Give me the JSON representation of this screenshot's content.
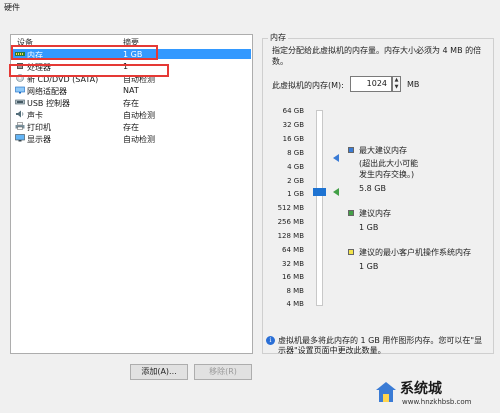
{
  "window": {
    "title": "硬件"
  },
  "device_list": {
    "header": {
      "device": "设备",
      "summary": "摘要"
    },
    "items": [
      {
        "name": "内存",
        "summary": "1 GB",
        "icon": "memory-icon"
      },
      {
        "name": "处理器",
        "summary": "1",
        "icon": "processor-icon"
      },
      {
        "name": "新 CD/DVD (SATA)",
        "summary": "自动检测",
        "icon": "cd-dvd-icon"
      },
      {
        "name": "网络适配器",
        "summary": "NAT",
        "icon": "network-adapter-icon"
      },
      {
        "name": "USB 控制器",
        "summary": "存在",
        "icon": "usb-icon"
      },
      {
        "name": "声卡",
        "summary": "自动检测",
        "icon": "speaker-icon"
      },
      {
        "name": "打印机",
        "summary": "存在",
        "icon": "printer-icon"
      },
      {
        "name": "显示器",
        "summary": "自动检测",
        "icon": "display-icon"
      }
    ]
  },
  "buttons": {
    "add": "添加(A)...",
    "remove": "移除(R)"
  },
  "memory": {
    "group_title": "内存",
    "description": "指定分配给此虚拟机的内存量。内存大小必须为 4 MB 的倍数。",
    "field_label": "此虚拟机的内存(M):",
    "value": "1024",
    "unit": "MB",
    "scale_labels": [
      "64 GB",
      "32 GB",
      "16 GB",
      "8 GB",
      "4 GB",
      "2 GB",
      "1 GB",
      "512 MB",
      "256 MB",
      "128 MB",
      "64 MB",
      "32 MB",
      "16 MB",
      "8 MB",
      "4 MB"
    ],
    "legend": {
      "max_recommended_title": "最大建议内存",
      "max_recommended_note_1": "(超出此大小可能",
      "max_recommended_note_2": "发生内存交换。)",
      "max_recommended_value": "5.8 GB",
      "recommended_title": "建议内存",
      "recommended_value": "1 GB",
      "min_guest_title": "建议的最小客户机操作系统内存",
      "min_guest_value": "1 GB"
    },
    "info": "虚拟机最多将此内存的 1 GB 用作图形内存。您可以在\"显示器\"设置页面中更改此数量。"
  },
  "colors": {
    "selection": "#3399ff",
    "highlight_box": "#e53935",
    "max_marker": "#3a7bd5",
    "recommended_marker": "#43a047",
    "min_marker": "#f2e34a"
  },
  "watermark": {
    "brand": "系统城",
    "url": "www.hnzkhbsb.com"
  }
}
